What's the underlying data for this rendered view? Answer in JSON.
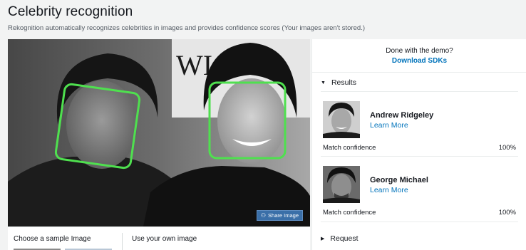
{
  "header": {
    "title": "Celebrity recognition",
    "subtitle": "Rekognition automatically recognizes celebrities in images and provides confidence scores (Your images aren't stored.)"
  },
  "image": {
    "backdrop_text": "WI  THE",
    "share_label": "Share Image",
    "share_icon": "share-icon",
    "face_box_color": "#4fe04f"
  },
  "samples": {
    "choose_label": "Choose a sample Image",
    "own_label": "Use your own image"
  },
  "panel": {
    "done_text": "Done with the demo?",
    "download_label": "Download SDKs",
    "results_label": "Results",
    "request_label": "Request",
    "celebrities": [
      {
        "name": "Andrew Ridgeley",
        "learn_more": "Learn More",
        "confidence_label": "Match confidence",
        "confidence": "100%"
      },
      {
        "name": "George Michael",
        "learn_more": "Learn More",
        "confidence_label": "Match confidence",
        "confidence": "100%"
      }
    ]
  },
  "colors": {
    "link": "#0073bb",
    "background": "#f2f3f3",
    "share_button": "#3a6fa8"
  }
}
